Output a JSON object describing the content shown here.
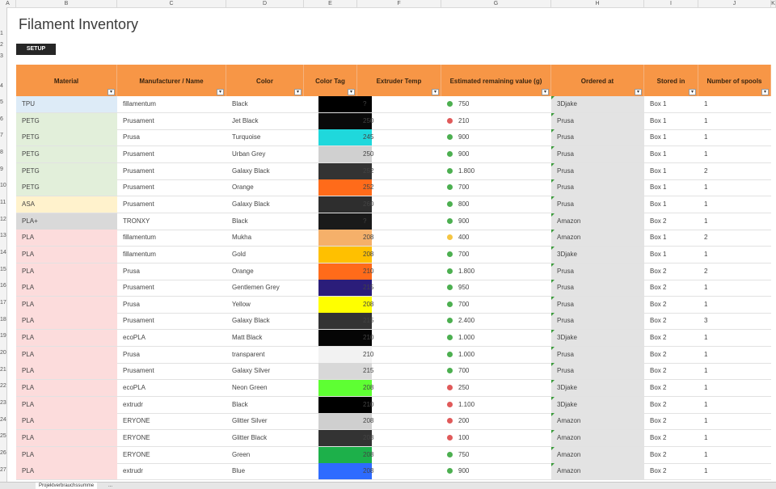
{
  "app": {
    "title": "Filament Inventory",
    "setup_label": "SETUP"
  },
  "column_letters": [
    "A",
    "B",
    "C",
    "D",
    "E",
    "F",
    "G",
    "H",
    "I",
    "J",
    "K"
  ],
  "row_numbers": [
    "1",
    "2",
    "3",
    "4",
    "5",
    "6",
    "7",
    "8",
    "9",
    "10",
    "11",
    "12",
    "13",
    "14",
    "15",
    "16",
    "17",
    "18",
    "19",
    "20",
    "21",
    "22",
    "23",
    "24",
    "25",
    "26",
    "27"
  ],
  "headers": [
    "Material",
    "Manufacturer / Name",
    "Color",
    "Color Tag",
    "Extruder Temp",
    "Estimated remaining value (g)",
    "Ordered at",
    "Stored in",
    "Number of spools"
  ],
  "colors": {
    "header_orange": "#f79646",
    "status_green": "#4caf50",
    "status_red": "#e05a5a",
    "status_yellow": "#f5c542"
  },
  "rows": [
    {
      "material": "TPU",
      "mfr": "fillamentum",
      "color": "Black",
      "swatch": "#000000",
      "temp": "?",
      "status": "green",
      "value": "750",
      "ordered": "3Djake",
      "stored": "Box 1",
      "spools": "1",
      "matbg": "#ddebf7"
    },
    {
      "material": "PETG",
      "mfr": "Prusament",
      "color": "Jet Black",
      "swatch": "#0a0a0a",
      "temp": "250",
      "status": "red",
      "value": "210",
      "ordered": "Prusa",
      "stored": "Box 1",
      "spools": "1",
      "matbg": "#e2efda"
    },
    {
      "material": "PETG",
      "mfr": "Prusa",
      "color": "Turquoise",
      "swatch": "#1fd8dc",
      "temp": "245",
      "status": "green",
      "value": "900",
      "ordered": "Prusa",
      "stored": "Box 1",
      "spools": "1",
      "matbg": "#e2efda"
    },
    {
      "material": "PETG",
      "mfr": "Prusament",
      "color": "Urban Grey",
      "swatch": "#d0d0d0",
      "temp": "250",
      "status": "green",
      "value": "900",
      "ordered": "Prusa",
      "stored": "Box 1",
      "spools": "1",
      "matbg": "#e2efda"
    },
    {
      "material": "PETG",
      "mfr": "Prusament",
      "color": "Galaxy Black",
      "swatch": "#333333",
      "temp": "252",
      "status": "green",
      "value": "1.800",
      "ordered": "Prusa",
      "stored": "Box 1",
      "spools": "2",
      "matbg": "#e2efda"
    },
    {
      "material": "PETG",
      "mfr": "Prusament",
      "color": "Orange",
      "swatch": "#ff6b1a",
      "temp": "252",
      "status": "green",
      "value": "700",
      "ordered": "Prusa",
      "stored": "Box 1",
      "spools": "1",
      "matbg": "#e2efda"
    },
    {
      "material": "ASA",
      "mfr": "Prusament",
      "color": "Galaxy Black",
      "swatch": "#2e2e2e",
      "temp": "260",
      "status": "green",
      "value": "800",
      "ordered": "Prusa",
      "stored": "Box 1",
      "spools": "1",
      "matbg": "#fff2cc"
    },
    {
      "material": "PLA+",
      "mfr": "TRONXY",
      "color": "Black",
      "swatch": "#1a1a1a",
      "temp": "?",
      "status": "green",
      "value": "900",
      "ordered": "Amazon",
      "stored": "Box 2",
      "spools": "1",
      "matbg": "#d9d9d9"
    },
    {
      "material": "PLA",
      "mfr": "fillamentum",
      "color": "Mukha",
      "swatch": "#f5b06a",
      "temp": "208",
      "status": "yellow",
      "value": "400",
      "ordered": "Amazon",
      "stored": "Box 1",
      "spools": "2",
      "matbg": "#fcdcdc"
    },
    {
      "material": "PLA",
      "mfr": "fillamentum",
      "color": "Gold",
      "swatch": "#ffc000",
      "temp": "208",
      "status": "green",
      "value": "700",
      "ordered": "3Djake",
      "stored": "Box 1",
      "spools": "1",
      "matbg": "#fcdcdc"
    },
    {
      "material": "PLA",
      "mfr": "Prusa",
      "color": "Orange",
      "swatch": "#ff6b1a",
      "temp": "210",
      "status": "green",
      "value": "1.800",
      "ordered": "Prusa",
      "stored": "Box 2",
      "spools": "2",
      "matbg": "#fcdcdc"
    },
    {
      "material": "PLA",
      "mfr": "Prusament",
      "color": "Gentlemen Grey",
      "swatch": "#2b1d7a",
      "temp": "215",
      "status": "green",
      "value": "950",
      "ordered": "Prusa",
      "stored": "Box 2",
      "spools": "1",
      "matbg": "#fcdcdc"
    },
    {
      "material": "PLA",
      "mfr": "Prusa",
      "color": "Yellow",
      "swatch": "#ffff00",
      "temp": "208",
      "status": "green",
      "value": "700",
      "ordered": "Prusa",
      "stored": "Box 2",
      "spools": "1",
      "matbg": "#fcdcdc"
    },
    {
      "material": "PLA",
      "mfr": "Prusament",
      "color": "Galaxy Black",
      "swatch": "#333333",
      "temp": "215",
      "status": "green",
      "value": "2.400",
      "ordered": "Prusa",
      "stored": "Box 2",
      "spools": "3",
      "matbg": "#fcdcdc"
    },
    {
      "material": "PLA",
      "mfr": "ecoPLA",
      "color": "Matt Black",
      "swatch": "#050505",
      "temp": "210",
      "status": "green",
      "value": "1.000",
      "ordered": "3Djake",
      "stored": "Box 2",
      "spools": "1",
      "matbg": "#fcdcdc"
    },
    {
      "material": "PLA",
      "mfr": "Prusa",
      "color": "transparent",
      "swatch": "#f2f2f2",
      "temp": "210",
      "status": "green",
      "value": "1.000",
      "ordered": "Prusa",
      "stored": "Box 2",
      "spools": "1",
      "matbg": "#fcdcdc"
    },
    {
      "material": "PLA",
      "mfr": "Prusament",
      "color": "Galaxy Silver",
      "swatch": "#d8d8d8",
      "temp": "215",
      "status": "green",
      "value": "700",
      "ordered": "Prusa",
      "stored": "Box 2",
      "spools": "1",
      "matbg": "#fcdcdc"
    },
    {
      "material": "PLA",
      "mfr": "ecoPLA",
      "color": "Neon Green",
      "swatch": "#5eff33",
      "temp": "208",
      "status": "red",
      "value": "250",
      "ordered": "3Djake",
      "stored": "Box 2",
      "spools": "1",
      "matbg": "#fcdcdc"
    },
    {
      "material": "PLA",
      "mfr": "extrudr",
      "color": "Black",
      "swatch": "#000000",
      "temp": "210",
      "status": "red",
      "value": "1.100",
      "ordered": "3Djake",
      "stored": "Box 2",
      "spools": "1",
      "matbg": "#fcdcdc"
    },
    {
      "material": "PLA",
      "mfr": "ERYONE",
      "color": "Glitter Silver",
      "swatch": "#cfcfcf",
      "temp": "208",
      "status": "red",
      "value": "200",
      "ordered": "Amazon",
      "stored": "Box 2",
      "spools": "1",
      "matbg": "#fcdcdc"
    },
    {
      "material": "PLA",
      "mfr": "ERYONE",
      "color": "Glitter Black",
      "swatch": "#333333",
      "temp": "208",
      "status": "red",
      "value": "100",
      "ordered": "Amazon",
      "stored": "Box 2",
      "spools": "1",
      "matbg": "#fcdcdc"
    },
    {
      "material": "PLA",
      "mfr": "ERYONE",
      "color": "Green",
      "swatch": "#1db04a",
      "temp": "208",
      "status": "green",
      "value": "750",
      "ordered": "Amazon",
      "stored": "Box 2",
      "spools": "1",
      "matbg": "#fcdcdc"
    },
    {
      "material": "PLA",
      "mfr": "extrudr",
      "color": "Blue",
      "swatch": "#2e6bff",
      "temp": "208",
      "status": "green",
      "value": "900",
      "ordered": "Amazon",
      "stored": "Box 2",
      "spools": "1",
      "matbg": "#fcdcdc"
    }
  ],
  "sheet_tabs": [
    "Projektverbrauchssumme",
    "..."
  ]
}
